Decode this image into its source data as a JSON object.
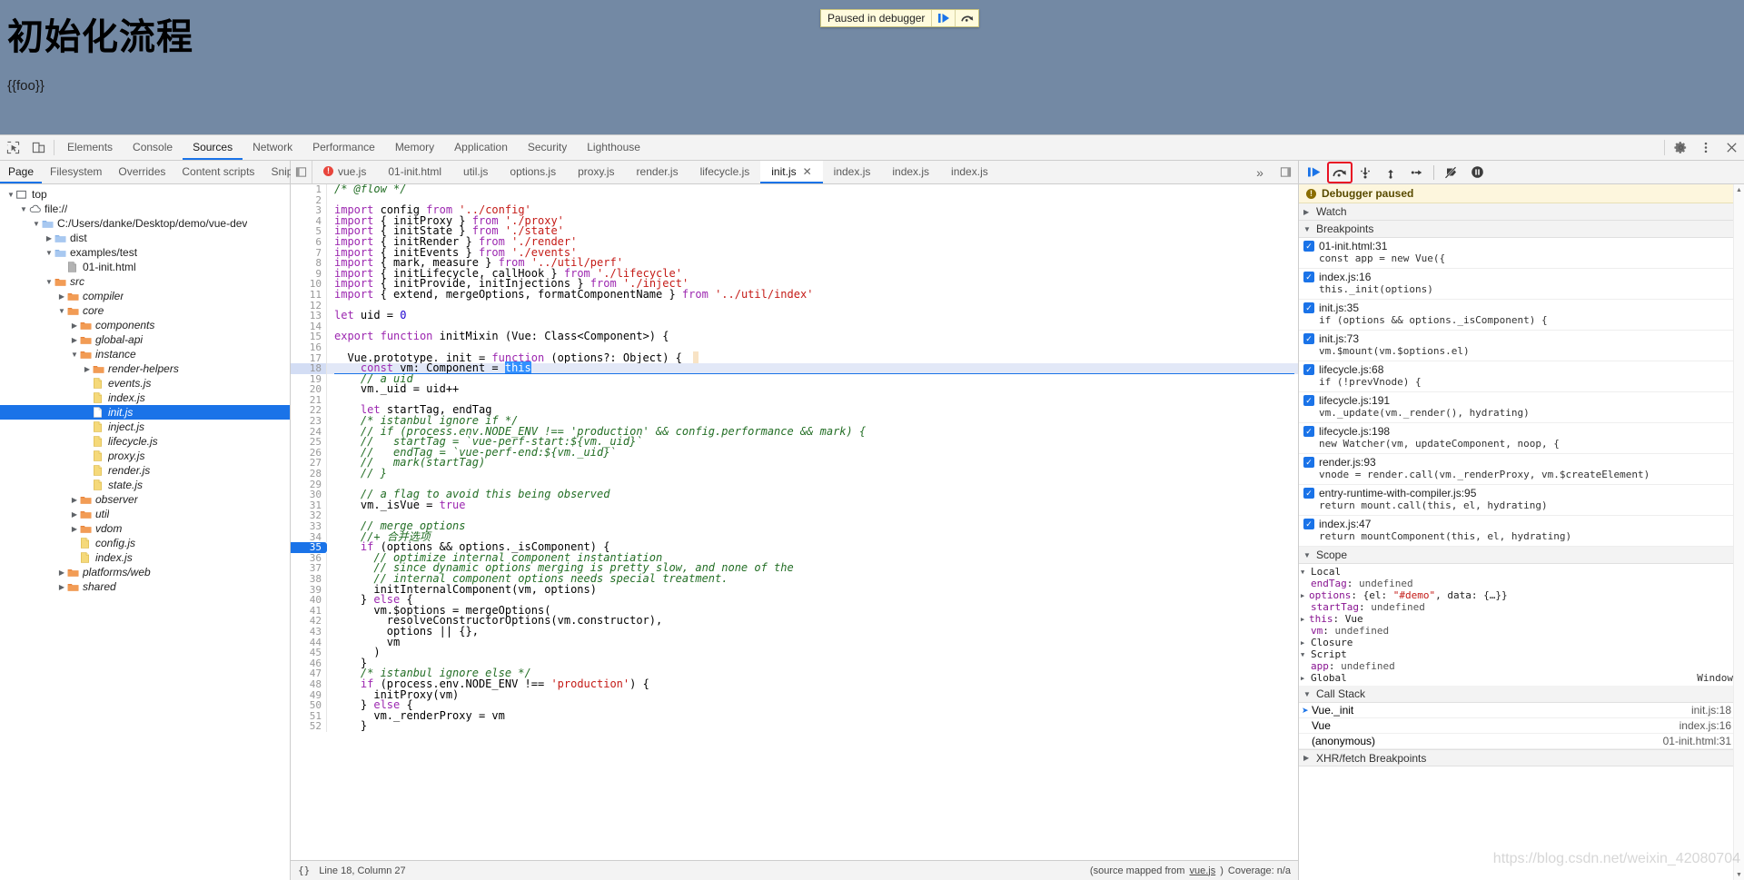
{
  "page": {
    "title": "初始化流程",
    "interpolation": "{{foo}}",
    "background_color": "#7389a4"
  },
  "paused_overlay": {
    "label": "Paused in debugger",
    "resume_icon": "resume-play-icon",
    "step_over_icon": "step-over-icon"
  },
  "devtools": {
    "left_icons": [
      "inspect-element-icon",
      "device-toolbar-icon"
    ],
    "tabs": [
      {
        "label": "Elements",
        "active": false
      },
      {
        "label": "Console",
        "active": false
      },
      {
        "label": "Sources",
        "active": true
      },
      {
        "label": "Network",
        "active": false
      },
      {
        "label": "Performance",
        "active": false
      },
      {
        "label": "Memory",
        "active": false
      },
      {
        "label": "Application",
        "active": false
      },
      {
        "label": "Security",
        "active": false
      },
      {
        "label": "Lighthouse",
        "active": false
      }
    ],
    "right_icons": [
      "gear-icon",
      "more-vertical-icon",
      "close-icon"
    ]
  },
  "navigator": {
    "tabs": [
      {
        "label": "Page",
        "active": true
      },
      {
        "label": "Filesystem",
        "active": false
      },
      {
        "label": "Overrides",
        "active": false
      },
      {
        "label": "Content scripts",
        "active": false
      },
      {
        "label": "Snippets",
        "active": false
      }
    ],
    "more_label": "⋮",
    "tree": [
      {
        "label": "top",
        "indent": 0,
        "twisty": "open",
        "icon": "frame-icon",
        "italic": false,
        "selected": false
      },
      {
        "label": "file://",
        "indent": 1,
        "twisty": "open",
        "icon": "cloud-icon",
        "italic": false,
        "selected": false
      },
      {
        "label": "C:/Users/danke/Desktop/demo/vue-dev",
        "indent": 2,
        "twisty": "open",
        "icon": "folder-blue-icon",
        "italic": false,
        "selected": false
      },
      {
        "label": "dist",
        "indent": 3,
        "twisty": "closed",
        "icon": "folder-blue-icon",
        "italic": false,
        "selected": false
      },
      {
        "label": "examples/test",
        "indent": 3,
        "twisty": "open",
        "icon": "folder-blue-icon",
        "italic": false,
        "selected": false
      },
      {
        "label": "01-init.html",
        "indent": 4,
        "twisty": "none",
        "icon": "file-gray-icon",
        "italic": false,
        "selected": false
      },
      {
        "label": "src",
        "indent": 3,
        "twisty": "open",
        "icon": "folder-orange-icon",
        "italic": true,
        "selected": false
      },
      {
        "label": "compiler",
        "indent": 4,
        "twisty": "closed",
        "icon": "folder-orange-icon",
        "italic": true,
        "selected": false
      },
      {
        "label": "core",
        "indent": 4,
        "twisty": "open",
        "icon": "folder-orange-icon",
        "italic": true,
        "selected": false
      },
      {
        "label": "components",
        "indent": 5,
        "twisty": "closed",
        "icon": "folder-orange-icon",
        "italic": true,
        "selected": false
      },
      {
        "label": "global-api",
        "indent": 5,
        "twisty": "closed",
        "icon": "folder-orange-icon",
        "italic": true,
        "selected": false
      },
      {
        "label": "instance",
        "indent": 5,
        "twisty": "open",
        "icon": "folder-orange-icon",
        "italic": true,
        "selected": false
      },
      {
        "label": "render-helpers",
        "indent": 6,
        "twisty": "closed",
        "icon": "folder-orange-icon",
        "italic": true,
        "selected": false
      },
      {
        "label": "events.js",
        "indent": 6,
        "twisty": "none",
        "icon": "file-yellow-icon",
        "italic": true,
        "selected": false
      },
      {
        "label": "index.js",
        "indent": 6,
        "twisty": "none",
        "icon": "file-yellow-icon",
        "italic": true,
        "selected": false
      },
      {
        "label": "init.js",
        "indent": 6,
        "twisty": "none",
        "icon": "file-white-icon",
        "italic": true,
        "selected": true
      },
      {
        "label": "inject.js",
        "indent": 6,
        "twisty": "none",
        "icon": "file-yellow-icon",
        "italic": true,
        "selected": false
      },
      {
        "label": "lifecycle.js",
        "indent": 6,
        "twisty": "none",
        "icon": "file-yellow-icon",
        "italic": true,
        "selected": false
      },
      {
        "label": "proxy.js",
        "indent": 6,
        "twisty": "none",
        "icon": "file-yellow-icon",
        "italic": true,
        "selected": false
      },
      {
        "label": "render.js",
        "indent": 6,
        "twisty": "none",
        "icon": "file-yellow-icon",
        "italic": true,
        "selected": false
      },
      {
        "label": "state.js",
        "indent": 6,
        "twisty": "none",
        "icon": "file-yellow-icon",
        "italic": true,
        "selected": false
      },
      {
        "label": "observer",
        "indent": 5,
        "twisty": "closed",
        "icon": "folder-orange-icon",
        "italic": true,
        "selected": false
      },
      {
        "label": "util",
        "indent": 5,
        "twisty": "closed",
        "icon": "folder-orange-icon",
        "italic": true,
        "selected": false
      },
      {
        "label": "vdom",
        "indent": 5,
        "twisty": "closed",
        "icon": "folder-orange-icon",
        "italic": true,
        "selected": false
      },
      {
        "label": "config.js",
        "indent": 5,
        "twisty": "none",
        "icon": "file-yellow-icon",
        "italic": true,
        "selected": false
      },
      {
        "label": "index.js",
        "indent": 5,
        "twisty": "none",
        "icon": "file-yellow-icon",
        "italic": true,
        "selected": false
      },
      {
        "label": "platforms/web",
        "indent": 4,
        "twisty": "closed",
        "icon": "folder-orange-icon",
        "italic": true,
        "selected": false
      },
      {
        "label": "shared",
        "indent": 4,
        "twisty": "closed",
        "icon": "folder-orange-icon",
        "italic": true,
        "selected": false
      }
    ]
  },
  "editor": {
    "tabs": [
      {
        "label": "vue.js",
        "active": false,
        "error": true,
        "closable": false
      },
      {
        "label": "01-init.html",
        "active": false,
        "error": false,
        "closable": false
      },
      {
        "label": "util.js",
        "active": false,
        "error": false,
        "closable": false
      },
      {
        "label": "options.js",
        "active": false,
        "error": false,
        "closable": false
      },
      {
        "label": "proxy.js",
        "active": false,
        "error": false,
        "closable": false
      },
      {
        "label": "render.js",
        "active": false,
        "error": false,
        "closable": false
      },
      {
        "label": "lifecycle.js",
        "active": false,
        "error": false,
        "closable": false
      },
      {
        "label": "init.js",
        "active": true,
        "error": false,
        "closable": true
      },
      {
        "label": "index.js",
        "active": false,
        "error": false,
        "closable": false
      },
      {
        "label": "index.js",
        "active": false,
        "error": false,
        "closable": false
      },
      {
        "label": "index.js",
        "active": false,
        "error": false,
        "closable": false
      }
    ],
    "overflow_label": "»",
    "inline_value": "options = {el: \"#demo\", data: {…}}",
    "selected_token": "this",
    "status": {
      "format_icon": "{}",
      "cursor": "Line 18, Column 27",
      "source_map": "(source mapped from",
      "source_map_link": "vue.js",
      "source_map_tail": ")",
      "coverage": "Coverage: n/a"
    },
    "lines": [
      {
        "n": 1,
        "text": "/* @flow */",
        "cls": "cmt"
      },
      {
        "n": 2,
        "text": "",
        "cls": "pl"
      },
      {
        "n": 3,
        "text": "import config from '../config'",
        "cls": "imp"
      },
      {
        "n": 4,
        "text": "import { initProxy } from './proxy'",
        "cls": "imp"
      },
      {
        "n": 5,
        "text": "import { initState } from './state'",
        "cls": "imp"
      },
      {
        "n": 6,
        "text": "import { initRender } from './render'",
        "cls": "imp"
      },
      {
        "n": 7,
        "text": "import { initEvents } from './events'",
        "cls": "imp"
      },
      {
        "n": 8,
        "text": "import { mark, measure } from '../util/perf'",
        "cls": "imp"
      },
      {
        "n": 9,
        "text": "import { initLifecycle, callHook } from './lifecycle'",
        "cls": "imp"
      },
      {
        "n": 10,
        "text": "import { initProvide, initInjections } from './inject'",
        "cls": "imp"
      },
      {
        "n": 11,
        "text": "import { extend, mergeOptions, formatComponentName } from '../util/index'",
        "cls": "imp"
      },
      {
        "n": 12,
        "text": "",
        "cls": "pl"
      },
      {
        "n": 13,
        "text": "let uid = 0",
        "cls": "code"
      },
      {
        "n": 14,
        "text": "",
        "cls": "pl"
      },
      {
        "n": 15,
        "text": "export function initMixin (Vue: Class<Component>) {",
        "cls": "code"
      },
      {
        "n": 16,
        "text": "",
        "cls": "pl"
      },
      {
        "n": 17,
        "text": "  Vue.prototype._init = function (options?: Object) {",
        "cls": "code"
      },
      {
        "n": 18,
        "text": "    const vm: Component = this",
        "cls": "code"
      },
      {
        "n": 19,
        "text": "    // a uid",
        "cls": "cmt"
      },
      {
        "n": 20,
        "text": "    vm._uid = uid++",
        "cls": "code"
      },
      {
        "n": 21,
        "text": "",
        "cls": "pl"
      },
      {
        "n": 22,
        "text": "    let startTag, endTag",
        "cls": "code"
      },
      {
        "n": 23,
        "text": "    /* istanbul ignore if */",
        "cls": "cmt"
      },
      {
        "n": 24,
        "text": "    // if (process.env.NODE_ENV !== 'production' && config.performance && mark) {",
        "cls": "cmt"
      },
      {
        "n": 25,
        "text": "    //   startTag = `vue-perf-start:${vm._uid}`",
        "cls": "cmt"
      },
      {
        "n": 26,
        "text": "    //   endTag = `vue-perf-end:${vm._uid}`",
        "cls": "cmt"
      },
      {
        "n": 27,
        "text": "    //   mark(startTag)",
        "cls": "cmt"
      },
      {
        "n": 28,
        "text": "    // }",
        "cls": "cmt"
      },
      {
        "n": 29,
        "text": "",
        "cls": "pl"
      },
      {
        "n": 30,
        "text": "    // a flag to avoid this being observed",
        "cls": "cmt"
      },
      {
        "n": 31,
        "text": "    vm._isVue = true",
        "cls": "code"
      },
      {
        "n": 32,
        "text": "",
        "cls": "pl"
      },
      {
        "n": 33,
        "text": "    // merge options",
        "cls": "cmt"
      },
      {
        "n": 34,
        "text": "    //+ 合并选项",
        "cls": "cmt"
      },
      {
        "n": 35,
        "text": "    if (options && options._isComponent) {",
        "cls": "code"
      },
      {
        "n": 36,
        "text": "      // optimize internal component instantiation",
        "cls": "cmt"
      },
      {
        "n": 37,
        "text": "      // since dynamic options merging is pretty slow, and none of the",
        "cls": "cmt"
      },
      {
        "n": 38,
        "text": "      // internal component options needs special treatment.",
        "cls": "cmt"
      },
      {
        "n": 39,
        "text": "      initInternalComponent(vm, options)",
        "cls": "code"
      },
      {
        "n": 40,
        "text": "    } else {",
        "cls": "code"
      },
      {
        "n": 41,
        "text": "      vm.$options = mergeOptions(",
        "cls": "code"
      },
      {
        "n": 42,
        "text": "        resolveConstructorOptions(vm.constructor),",
        "cls": "code"
      },
      {
        "n": 43,
        "text": "        options || {},",
        "cls": "code"
      },
      {
        "n": 44,
        "text": "        vm",
        "cls": "code"
      },
      {
        "n": 45,
        "text": "      )",
        "cls": "code"
      },
      {
        "n": 46,
        "text": "    }",
        "cls": "code"
      },
      {
        "n": 47,
        "text": "    /* istanbul ignore else */",
        "cls": "cmt"
      },
      {
        "n": 48,
        "text": "    if (process.env.NODE_ENV !== 'production') {",
        "cls": "code"
      },
      {
        "n": 49,
        "text": "      initProxy(vm)",
        "cls": "code"
      },
      {
        "n": 50,
        "text": "    } else {",
        "cls": "code"
      },
      {
        "n": 51,
        "text": "      vm._renderProxy = vm",
        "cls": "code"
      },
      {
        "n": 52,
        "text": "    }",
        "cls": "code"
      }
    ],
    "current_line": 18,
    "breakpoint_line": 35
  },
  "debugger": {
    "toolbar": [
      {
        "name": "resume-script-execution-icon",
        "highlighted": false
      },
      {
        "name": "step-over-next-function-call-icon",
        "highlighted": true
      },
      {
        "name": "step-into-next-function-call-icon",
        "highlighted": false
      },
      {
        "name": "step-out-of-current-function-icon",
        "highlighted": false
      },
      {
        "name": "step-icon",
        "highlighted": false
      },
      {
        "name": "deactivate-breakpoints-icon",
        "highlighted": false
      },
      {
        "name": "pause-on-exceptions-icon",
        "highlighted": false
      }
    ],
    "paused_banner": "Debugger paused",
    "sections": {
      "watch": "Watch",
      "breakpoints": "Breakpoints",
      "scope": "Scope",
      "call_stack": "Call Stack",
      "xhr_breakpoints": "XHR/fetch Breakpoints"
    },
    "breakpoints": [
      {
        "location": "01-init.html:31",
        "code": "const app = new Vue({",
        "checked": true
      },
      {
        "location": "index.js:16",
        "code": "this._init(options)",
        "checked": true
      },
      {
        "location": "init.js:35",
        "code": "if (options && options._isComponent) {",
        "checked": true
      },
      {
        "location": "init.js:73",
        "code": "vm.$mount(vm.$options.el)",
        "checked": true
      },
      {
        "location": "lifecycle.js:68",
        "code": "if (!prevVnode) {",
        "checked": true
      },
      {
        "location": "lifecycle.js:191",
        "code": "vm._update(vm._render(), hydrating)",
        "checked": true
      },
      {
        "location": "lifecycle.js:198",
        "code": "new Watcher(vm, updateComponent, noop, {",
        "checked": true
      },
      {
        "location": "render.js:93",
        "code": "vnode = render.call(vm._renderProxy, vm.$createElement)",
        "checked": true
      },
      {
        "location": "entry-runtime-with-compiler.js:95",
        "code": "return mount.call(this, el, hydrating)",
        "checked": true
      },
      {
        "location": "index.js:47",
        "code": "return mountComponent(this, el, hydrating)",
        "checked": true
      }
    ],
    "scope": {
      "local_label": "Local",
      "local_vars": [
        {
          "name": "endTag",
          "value": "undefined",
          "expandable": false,
          "kind": "undef"
        },
        {
          "name": "options",
          "value": "{el: \"#demo\", data: {…}}",
          "expandable": true,
          "kind": "object"
        },
        {
          "name": "startTag",
          "value": "undefined",
          "expandable": false,
          "kind": "undef"
        },
        {
          "name": "this",
          "value": "Vue",
          "expandable": true,
          "kind": "plain"
        },
        {
          "name": "vm",
          "value": "undefined",
          "expandable": false,
          "kind": "undef"
        }
      ],
      "closure_label": "Closure",
      "script_label": "Script",
      "script_vars": [
        {
          "name": "app",
          "value": "undefined",
          "expandable": false,
          "kind": "undef"
        }
      ],
      "global_label": "Global",
      "global_value": "Window"
    },
    "call_stack": [
      {
        "fn": "Vue._init",
        "loc": "init.js:18",
        "current": true
      },
      {
        "fn": "Vue",
        "loc": "index.js:16",
        "current": false
      },
      {
        "fn": "(anonymous)",
        "loc": "01-init.html:31",
        "current": false
      }
    ]
  },
  "watermark": "https://blog.csdn.net/weixin_42080704"
}
